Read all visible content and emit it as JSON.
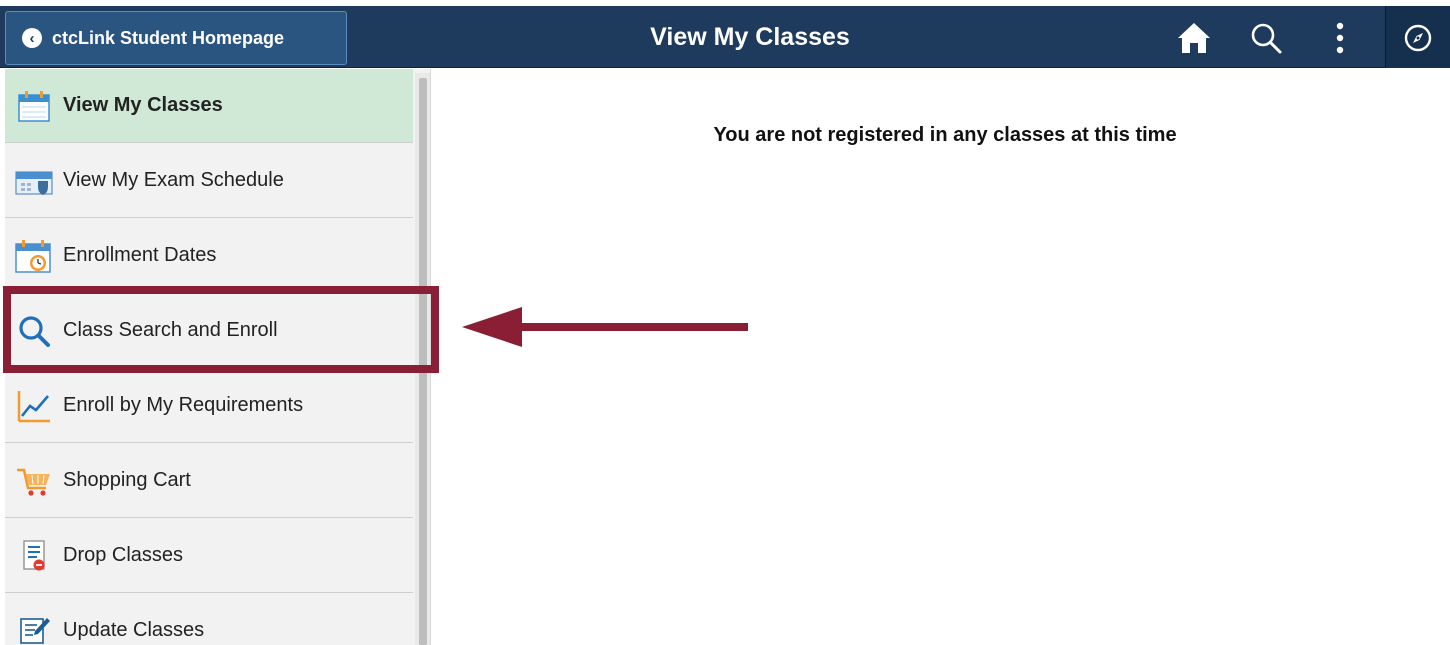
{
  "header": {
    "back_label": "ctcLink Student Homepage",
    "title": "View My Classes",
    "icons": [
      "home-icon",
      "search-icon",
      "more-options-icon",
      "navigator-icon"
    ]
  },
  "sidebar": {
    "items": [
      {
        "label": "View My Classes",
        "icon": "calendar-icon",
        "active": true
      },
      {
        "label": "View My Exam Schedule",
        "icon": "exam-calendar-icon",
        "active": false
      },
      {
        "label": "Enrollment Dates",
        "icon": "calendar-clock-icon",
        "active": false
      },
      {
        "label": "Class Search and Enroll",
        "icon": "magnifier-icon",
        "active": false
      },
      {
        "label": "Enroll by My Requirements",
        "icon": "line-chart-icon",
        "active": false
      },
      {
        "label": "Shopping Cart",
        "icon": "shopping-cart-icon",
        "active": false
      },
      {
        "label": "Drop Classes",
        "icon": "drop-list-icon",
        "active": false
      },
      {
        "label": "Update Classes",
        "icon": "edit-document-icon",
        "active": false
      }
    ]
  },
  "main": {
    "message": "You are not registered in any classes at this time"
  },
  "annotation": {
    "color": "#8a1e34",
    "highlighted_item": "Class Search and Enroll"
  }
}
